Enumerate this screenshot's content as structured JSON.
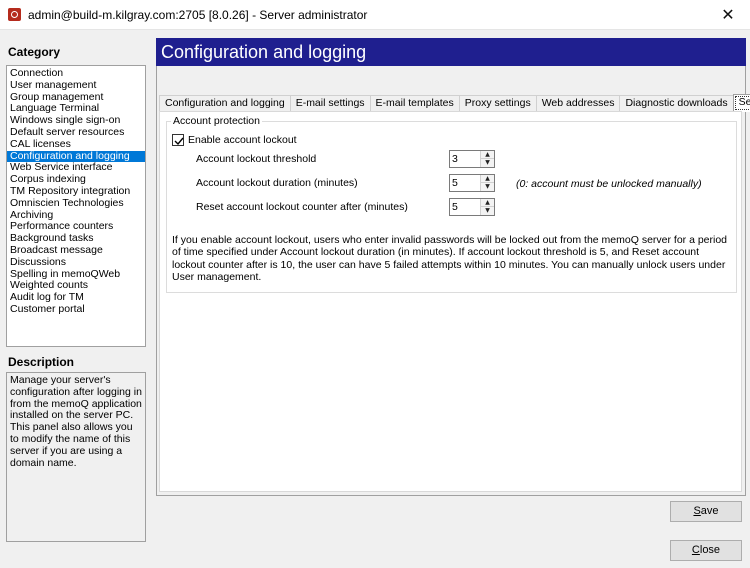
{
  "window": {
    "title": "admin@build-m.kilgray.com:2705 [8.0.26] - Server administrator",
    "close_glyph": "✕"
  },
  "sidebar": {
    "category_label": "Category",
    "items": [
      "Connection",
      "User management",
      "Group management",
      "Language Terminal",
      "Windows single sign-on",
      "Default server resources",
      "CAL licenses",
      "Configuration and logging",
      "Web Service interface",
      "Corpus indexing",
      "TM Repository integration",
      "Omniscien Technologies",
      "Archiving",
      "Performance counters",
      "Background tasks",
      "Broadcast message",
      "Discussions",
      "Spelling in memoQWeb",
      "Weighted counts",
      "Audit log for TM",
      "Customer portal"
    ],
    "selected_index": 7,
    "description_label": "Description",
    "description_text": "Manage your server's configuration after logging in from the memoQ application installed on the server PC. This panel also allows you to modify the name of this server if you are using a domain name."
  },
  "header": {
    "title": "Configuration and logging"
  },
  "tabs": [
    {
      "label": "Configuration and logging",
      "active": false
    },
    {
      "label": "E-mail settings",
      "active": false
    },
    {
      "label": "E-mail templates",
      "active": false
    },
    {
      "label": "Proxy settings",
      "active": false
    },
    {
      "label": "Web addresses",
      "active": false
    },
    {
      "label": "Diagnostic downloads",
      "active": false
    },
    {
      "label": "Security",
      "active": true
    }
  ],
  "security": {
    "group_label": "Account protection",
    "enable_lockout_label": "Enable account lockout",
    "enable_lockout_checked": true,
    "threshold_label": "Account lockout threshold",
    "threshold_value": "3",
    "duration_label": "Account lockout duration (minutes)",
    "duration_value": "5",
    "duration_hint": "(0: account must be unlocked manually)",
    "reset_label": "Reset account lockout counter after (minutes)",
    "reset_value": "5",
    "info_text": "If you enable account lockout, users who enter invalid passwords will be locked out from the memoQ server for a period of time specified under Account lockout duration (in minutes). If account lockout threshold is 5, and Reset account lockout counter after is 10, the user can have 5 failed attempts within 10 minutes. You can manually unlock users under User management."
  },
  "buttons": {
    "save_label": "Save",
    "close_label": "Close"
  },
  "colors": {
    "header_bg": "#1f1f8f",
    "selection": "#0078d7"
  }
}
